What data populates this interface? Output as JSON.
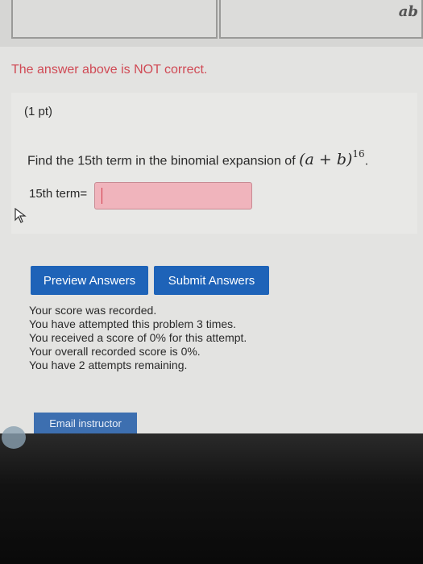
{
  "header": {
    "corner_preview_text": "ab"
  },
  "feedback_banner": {
    "message": "The answer above is NOT correct."
  },
  "problem": {
    "points": "(1 pt)",
    "prompt": "Find the 15th term in the binomial expansion of",
    "expression": "(a + b)",
    "exponent": "16",
    "trailing": ".",
    "answer_label": "15th term=",
    "answer_value": ""
  },
  "buttons": {
    "preview": "Preview Answers",
    "submit": "Submit Answers",
    "email": "Email instructor"
  },
  "status_messages": [
    "Your score was recorded.",
    "You have attempted this problem 3 times.",
    "You received a score of 0% for this attempt.",
    "Your overall recorded score is 0%.",
    "You have 2 attempts remaining."
  ],
  "colors": {
    "error_text": "#d04a55",
    "button_blue": "#1e63b8",
    "incorrect_input": "#f0b4bc"
  },
  "icons": [
    "mouse-pointer-icon",
    "browser-taskbar-icon"
  ]
}
